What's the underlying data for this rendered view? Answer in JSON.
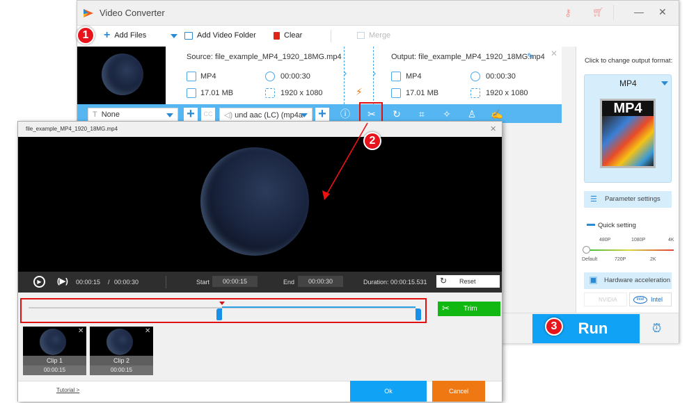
{
  "app": {
    "title": "Video Converter"
  },
  "titlebar": {
    "key_icon": "key-icon",
    "cart_icon": "cart-icon",
    "minimize": "—",
    "close": "✕"
  },
  "toolbar": {
    "add_files": "Add Files",
    "add_folder": "Add Video Folder",
    "clear": "Clear",
    "merge": "Merge"
  },
  "file": {
    "source_label": "Source: file_example_MP4_1920_18MG.mp4",
    "output_label": "Output: file_example_MP4_1920_18MG.mp4",
    "source": {
      "format": "MP4",
      "duration": "00:00:30",
      "size": "17.01 MB",
      "resolution": "1920 x 1080"
    },
    "output": {
      "format": "MP4",
      "duration": "00:00:30",
      "size": "17.01 MB",
      "resolution": "1920 x 1080"
    }
  },
  "editbar": {
    "subtitle": "None",
    "audio": "und aac (LC) (mp4a",
    "cc_label": "CC"
  },
  "rightpanel": {
    "change_format": "Click to change output format:",
    "format": "MP4",
    "format_icon_label": "MP4",
    "parameter_settings": "Parameter settings",
    "quick_setting": "Quick setting",
    "quality_top": [
      "480P",
      "1080P",
      "4K"
    ],
    "quality_bottom": [
      "Default",
      "720P",
      "2K"
    ],
    "quality_selected": "Default",
    "hw_accel": "Hardware acceleration",
    "nvidia": "NVIDIA",
    "intel": "Intel"
  },
  "run": {
    "label": "Run"
  },
  "dialog": {
    "title": "file_example_MP4_1920_18MG.mp4",
    "current_time": "00:00:15",
    "total_time": "00:00:30",
    "time_sep": "/",
    "start_label": "Start",
    "start_value": "00:00:15",
    "end_label": "End",
    "end_value": "00:00:30",
    "duration_label": "Duration:",
    "duration_value": "00:00:15.531",
    "reset": "Reset",
    "trim": "Trim",
    "playhead_fraction": 0.5,
    "selection_start_fraction": 0.5,
    "selection_end_fraction": 1.0,
    "clips": [
      {
        "label": "Clip 1",
        "duration": "00:00:15"
      },
      {
        "label": "Clip 2",
        "duration": "00:00:15"
      }
    ],
    "tutorial": "Tutorial >",
    "ok": "Ok",
    "cancel": "Cancel"
  },
  "annotations": {
    "step1": "1",
    "step2": "2",
    "step3": "3"
  },
  "colors": {
    "accent": "#10a2f5",
    "trim": "#12b812",
    "cancel": "#f07812",
    "highlight": "#e01010"
  }
}
